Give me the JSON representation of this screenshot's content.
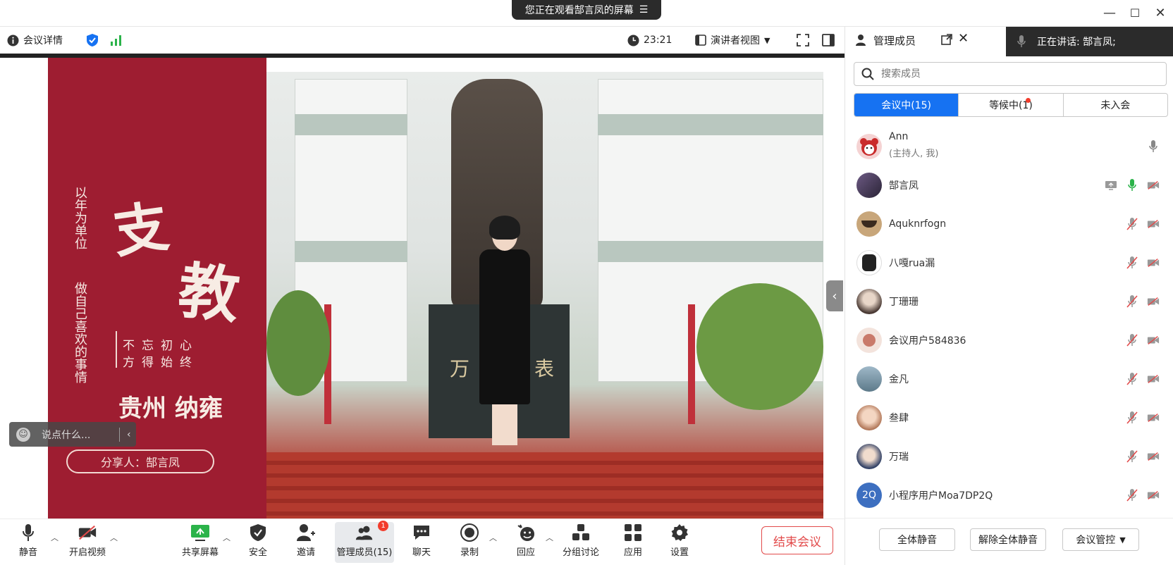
{
  "window": {
    "share_banner": "您正在观看郜言凤的屏幕",
    "minimize": "—",
    "maximize": "☐",
    "close": "✕"
  },
  "infobar": {
    "meeting_details": "会议详情",
    "timer": "23:21",
    "view_mode": "演讲者视图"
  },
  "slide": {
    "vertical_1": "以年为单位",
    "vertical_2": "做自己喜欢的事情",
    "big_1": "支",
    "big_2": "教",
    "motto_1": "不忘初心",
    "motto_2": "方得始终",
    "place": "贵州 纳雍",
    "sharer": "分享人：郜言凤",
    "statue_text_1": "万",
    "statue_text_2": "表"
  },
  "chat_quick": {
    "placeholder": "说点什么..."
  },
  "panel": {
    "title": "管理成员",
    "speaking": "正在讲话:  郜言凤;",
    "search_placeholder": "搜索成员",
    "tabs": [
      "会议中(15)",
      "等候中(1)",
      "未入会"
    ],
    "members": [
      {
        "name": "Ann",
        "sub": "(主持人, 我)",
        "avatar_color": "#f5d3d3",
        "initials": ""
      },
      {
        "name": "郜言凤",
        "sub": "",
        "avatar_color": "#4a3f58",
        "initials": ""
      },
      {
        "name": "Aquknrfogn",
        "sub": "",
        "avatar_color": "#c8a67a",
        "initials": ""
      },
      {
        "name": "八嘎rua漏",
        "sub": "",
        "avatar_color": "#ffffff",
        "initials": ""
      },
      {
        "name": "丁珊珊",
        "sub": "",
        "avatar_color": "#5a4a44",
        "initials": ""
      },
      {
        "name": "会议用户584836",
        "sub": "",
        "avatar_color": "#f3e3dc",
        "initials": ""
      },
      {
        "name": "金凡",
        "sub": "",
        "avatar_color": "#8aa4b8",
        "initials": ""
      },
      {
        "name": "叁肆",
        "sub": "",
        "avatar_color": "#e9c1a6",
        "initials": ""
      },
      {
        "name": "万瑞",
        "sub": "",
        "avatar_color": "#2e3e64",
        "initials": ""
      },
      {
        "name": "小程序用户Moa7DP2Q",
        "sub": "",
        "avatar_color": "#3d6fc0",
        "initials": "2Q"
      }
    ],
    "footer": {
      "mute_all": "全体静音",
      "unmute_all": "解除全体静音",
      "control": "会议管控"
    }
  },
  "toolbar": {
    "mute": "静音",
    "video": "开启视频",
    "share": "共享屏幕",
    "security": "安全",
    "invite": "邀请",
    "members": "管理成员(15)",
    "members_badge": "1",
    "chat": "聊天",
    "record": "录制",
    "reaction": "回应",
    "breakout": "分组讨论",
    "apps": "应用",
    "settings": "设置",
    "end": "结束会议"
  },
  "colors": {
    "accent": "#1672f2",
    "slide_red": "#9e1d31",
    "end_red": "#e24a4a",
    "badge_red": "#f23c2c"
  }
}
